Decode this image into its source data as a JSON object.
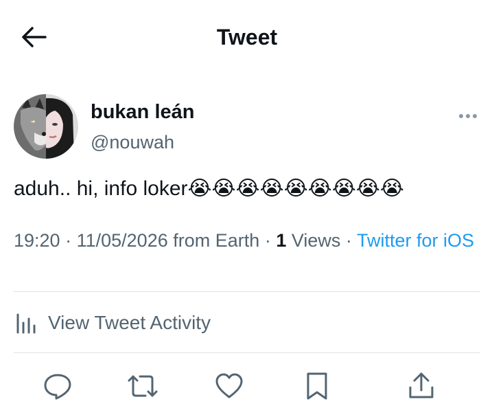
{
  "header": {
    "title": "Tweet",
    "back_icon": "arrow-left-icon"
  },
  "author": {
    "display_name": "bukan leán",
    "handle": "@nouwah",
    "more_icon": "more-horizontal-icon"
  },
  "tweet": {
    "text": "aduh.. hi, info loker😭😭😭😭😭😭😭😭😭"
  },
  "meta": {
    "time": "19:20",
    "date": "11/05/2026",
    "from": "from Earth",
    "views_count": "1",
    "views_label": "Views",
    "client": "Twitter for iOS"
  },
  "activity": {
    "label": "View Tweet Activity",
    "icon": "analytics-icon"
  },
  "actions": [
    "reply-icon",
    "retweet-icon",
    "like-icon",
    "bookmark-icon",
    "share-icon"
  ],
  "colors": {
    "link": "#1d9bf0",
    "secondary_text": "#536471",
    "primary_text": "#0f1419"
  }
}
